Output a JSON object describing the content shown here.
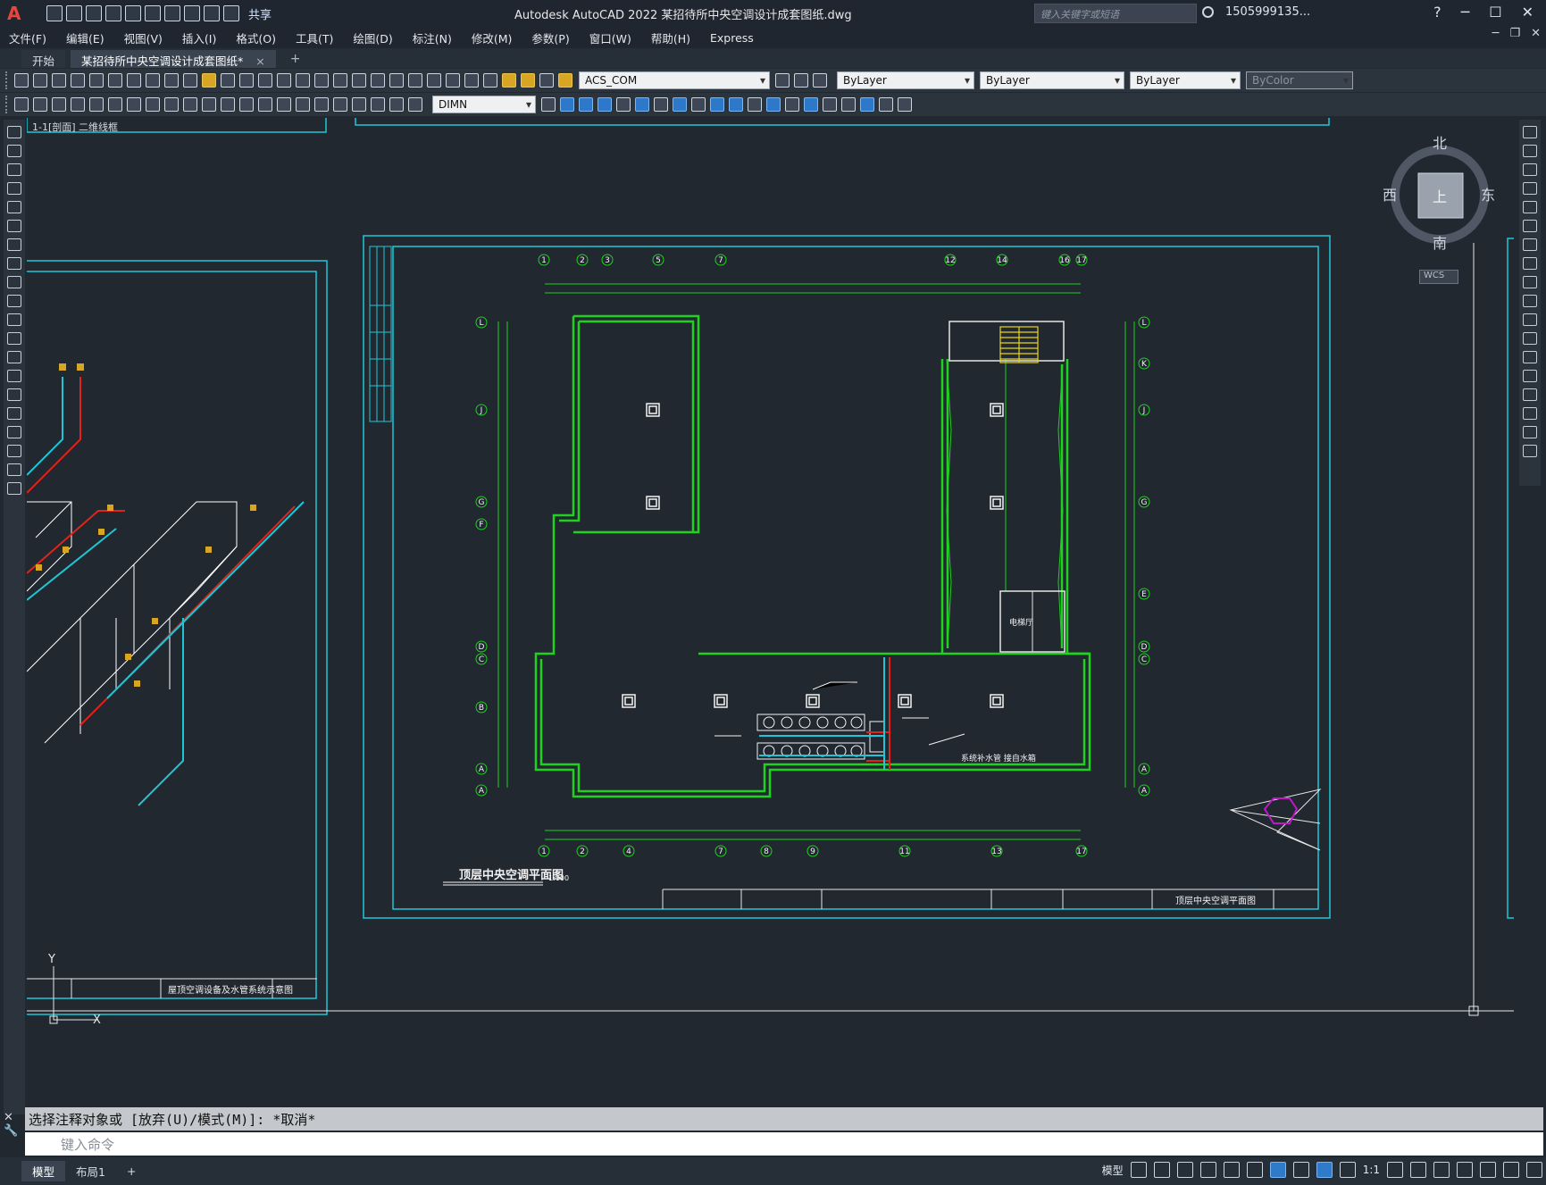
{
  "app": {
    "logo": "A",
    "share_label": "共享",
    "title": "Autodesk AutoCAD 2022    某招待所中央空调设计成套图纸.dwg",
    "search_placeholder": "键入关键字或短语",
    "user": "1505999135...",
    "help": "?"
  },
  "menu": [
    "文件(F)",
    "编辑(E)",
    "视图(V)",
    "插入(I)",
    "格式(O)",
    "工具(T)",
    "绘图(D)",
    "标注(N)",
    "修改(M)",
    "参数(P)",
    "窗口(W)",
    "帮助(H)",
    "Express"
  ],
  "tabs": {
    "start": "开始",
    "active": "某招待所中央空调设计成套图纸*",
    "close": "×",
    "add": "+"
  },
  "properties": {
    "layer": "ACS_COM",
    "color": "ByLayer",
    "linetype": "ByLayer",
    "lineweight": "ByLayer",
    "plotstyle": "ByColor",
    "dimstyle": "DIMN"
  },
  "viewcube": {
    "north": "北",
    "south": "南",
    "east": "东",
    "west": "西",
    "face": "上",
    "wcs": "WCS"
  },
  "drawing": {
    "left_sheet_title": "1-1[剖面] 二维线框",
    "left_title_block": "屋顶空调设备及水管系统示意图",
    "main_plan_title": "顶层中央空调平面图",
    "main_plan_scale": "1:100",
    "main_title_block": "顶层中央空调平面图",
    "room_label": "电梯厅",
    "note_label": "系统补水管 接自水箱",
    "axis_top": [
      "1",
      "2",
      "3",
      "5",
      "7",
      "12",
      "14",
      "16",
      "17"
    ],
    "axis_bottom": [
      "1",
      "2",
      "4",
      "7",
      "8",
      "9",
      "11",
      "13",
      "17"
    ],
    "axis_left": [
      "L",
      "J",
      "G",
      "F",
      "D",
      "C",
      "B",
      "A",
      "A"
    ],
    "axis_right": [
      "L",
      "K",
      "J",
      "G",
      "E",
      "D",
      "C",
      "A",
      "A"
    ],
    "ucs_y": "Y",
    "ucs_x": "X"
  },
  "command": {
    "history": "选择注释对象或 [放弃(U)/模式(M)]: *取消*",
    "placeholder": "键入命令"
  },
  "status": {
    "model_tab": "模型",
    "layout_tab": "布局1",
    "add": "+",
    "model_label": "模型",
    "scale": "1:1"
  }
}
